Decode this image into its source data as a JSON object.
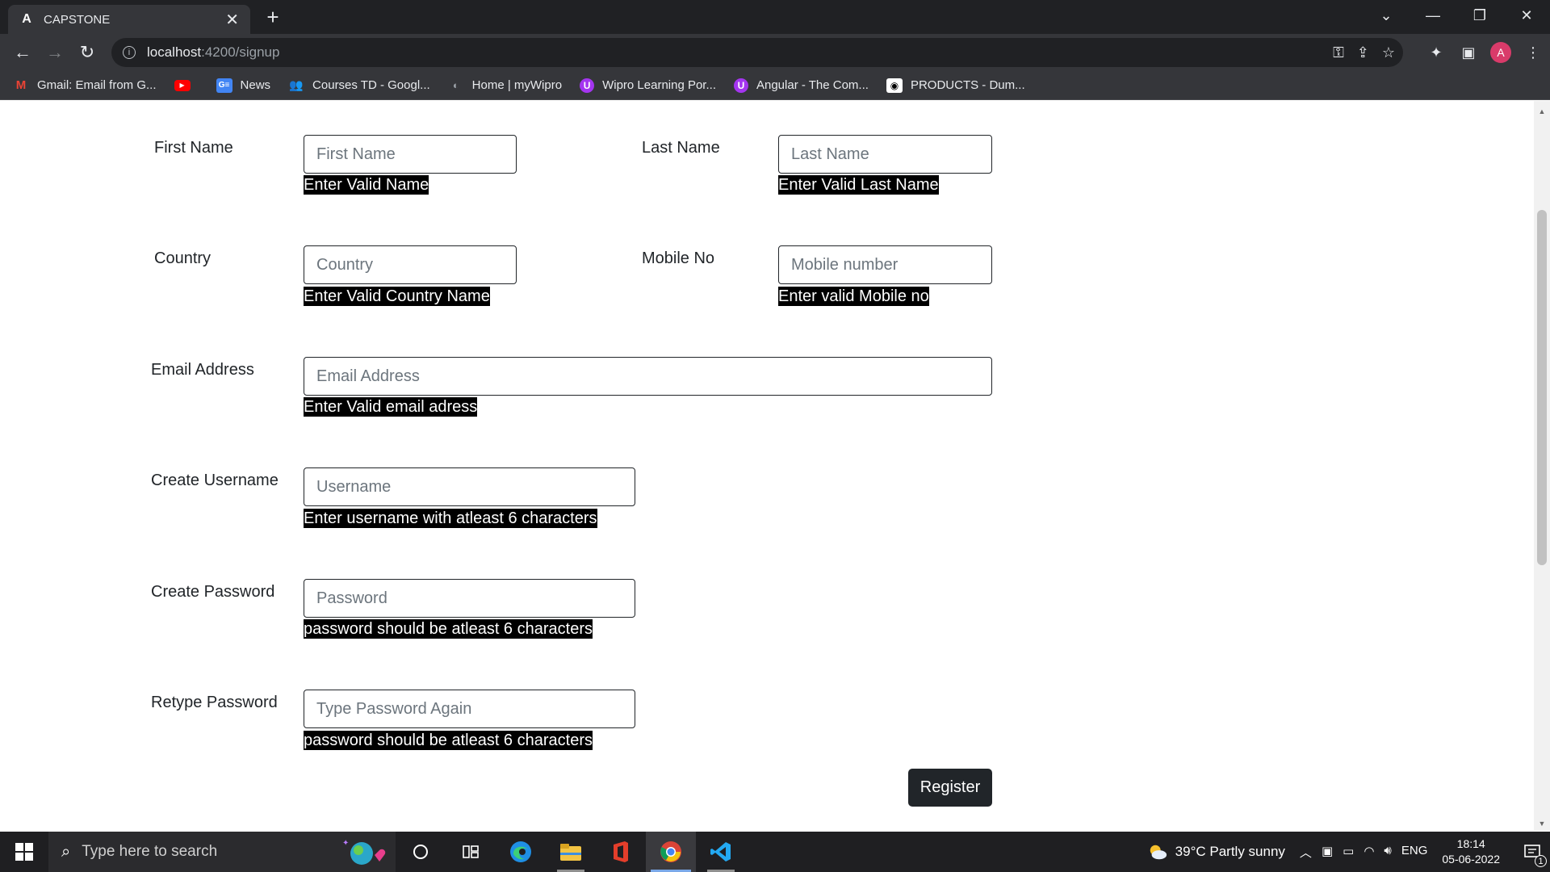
{
  "browser": {
    "tab_title": "CAPSTONE",
    "tab_favicon": "A",
    "url_host": "localhost",
    "url_path": ":4200/signup",
    "profile_initial": "A",
    "bookmarks": [
      {
        "label": "Gmail: Email from G...",
        "icon": "gmail-icon"
      },
      {
        "label": "",
        "icon": "youtube-icon"
      },
      {
        "label": "News",
        "icon": "google-news-icon"
      },
      {
        "label": "Courses TD - Googl...",
        "icon": "people-icon"
      },
      {
        "label": "Home | myWipro",
        "icon": "wipro-icon"
      },
      {
        "label": "Wipro Learning Por...",
        "icon": "udemy-icon"
      },
      {
        "label": "Angular - The Com...",
        "icon": "udemy-icon"
      },
      {
        "label": "PRODUCTS - Dum...",
        "icon": "globe-icon"
      }
    ]
  },
  "form": {
    "first_name": {
      "label": "First Name",
      "placeholder": "First Name",
      "error": "Enter Valid Name"
    },
    "last_name": {
      "label": "Last Name",
      "placeholder": "Last Name",
      "error": "Enter Valid Last Name"
    },
    "country": {
      "label": "Country",
      "placeholder": "Country",
      "error": "Enter Valid Country Name"
    },
    "mobile": {
      "label": "Mobile No",
      "placeholder": "Mobile number",
      "error": "Enter valid Mobile no"
    },
    "email": {
      "label": "Email Address",
      "placeholder": "Email Address",
      "error": "Enter Valid email adress"
    },
    "username": {
      "label": "Create Username",
      "placeholder": "Username",
      "error": "Enter username with atleast 6 characters"
    },
    "password": {
      "label": "Create Password",
      "placeholder": "Password",
      "error": "password should be atleast 6 characters"
    },
    "retype": {
      "label": "Retype Password",
      "placeholder": "Type Password Again",
      "error": "password should be atleast 6 characters"
    },
    "register_label": "Register"
  },
  "taskbar": {
    "search_placeholder": "Type here to search",
    "weather": "39°C  Partly sunny",
    "language": "ENG",
    "time": "18:14",
    "date": "05-06-2022",
    "notification_count": "1"
  },
  "colors": {
    "chrome_dark": "#202124",
    "chrome_toolbar": "#35363a",
    "button_dark": "#212529",
    "error_bg": "#000000",
    "avatar": "#d93b6a"
  }
}
